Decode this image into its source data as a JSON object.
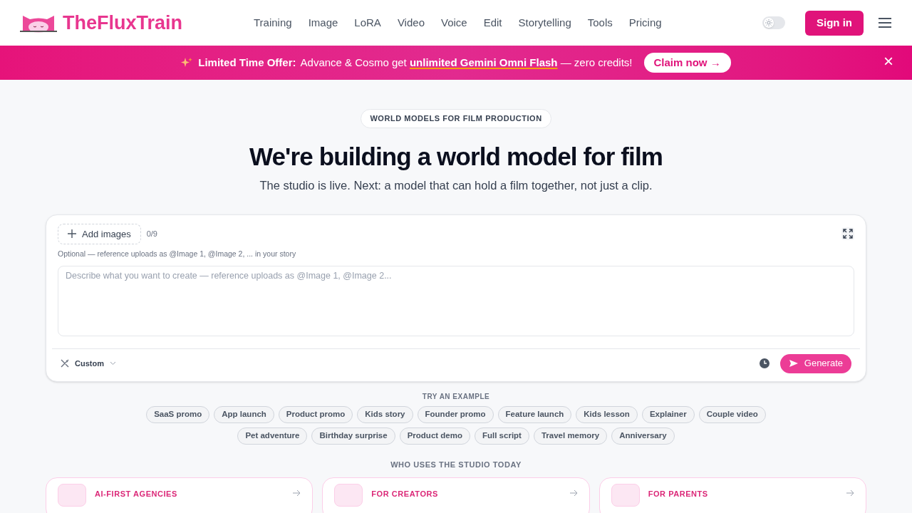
{
  "brand": {
    "name": "TheFluxTrain"
  },
  "nav": [
    {
      "label": "Training"
    },
    {
      "label": "Image"
    },
    {
      "label": "LoRA"
    },
    {
      "label": "Video"
    },
    {
      "label": "Voice"
    },
    {
      "label": "Edit"
    },
    {
      "label": "Storytelling"
    },
    {
      "label": "Tools"
    },
    {
      "label": "Pricing"
    }
  ],
  "theme_toggle": {
    "on": false
  },
  "sign_in": "Sign in",
  "banner": {
    "lead": "Limited Time Offer:",
    "text": "Advance & Cosmo get **unlimited Gemini Omni Flash** — zero credits!",
    "cta": "Claim now →",
    "close": "×"
  },
  "hero": {
    "badge": "WORLD MODELS FOR FILM PRODUCTION",
    "title": "We're building a world model for film",
    "subtitle": "The studio is live. Next: a model that can hold a film together, not just a clip."
  },
  "composer": {
    "add_images": "Add images",
    "count": "0/9",
    "hint": "Optional — reference uploads as @Image 1, @Image 2, ... in your story",
    "placeholder": "Describe what you want to create — reference uploads as @Image 1, @Image 2...",
    "mode": "Custom",
    "generate": "Generate"
  },
  "examples": {
    "heading": "TRY AN EXAMPLE",
    "items": [
      "SaaS promo",
      "App launch",
      "Product promo",
      "Kids story",
      "Founder promo",
      "Feature launch",
      "Kids lesson",
      "Explainer",
      "Couple video",
      "Pet adventure",
      "Birthday surprise",
      "Product demo",
      "Full script",
      "Travel memory",
      "Anniversary"
    ]
  },
  "audience": {
    "heading": "WHO USES THE STUDIO TODAY",
    "cards": [
      {
        "title": "AI-FIRST AGENCIES"
      },
      {
        "title": "FOR CREATORS"
      },
      {
        "title": "FOR PARENTS"
      }
    ]
  }
}
